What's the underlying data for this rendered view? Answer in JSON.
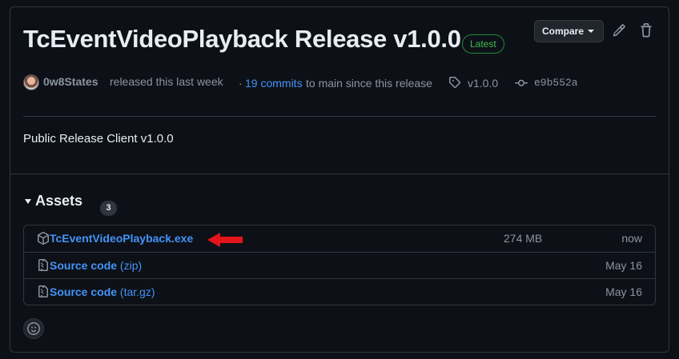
{
  "release": {
    "title": "TcEventVideoPlayback Release v1.0.0",
    "badge": "Latest",
    "compare_label": "Compare",
    "author": "0w8States",
    "released_text": "released this last week",
    "dot": "·",
    "commits_link": "19 commits",
    "commits_rest": "to main since this release",
    "tag": "v1.0.0",
    "commit": "e9b552a",
    "body": "Public Release Client v1.0.0"
  },
  "assets": {
    "label": "Assets",
    "count": "3",
    "items": [
      {
        "name": "TcEventVideoPlayback.exe",
        "ext": "",
        "size": "274 MB",
        "date": "now",
        "icon": "package-icon"
      },
      {
        "name": "Source code",
        "ext": "(zip)",
        "size": "",
        "date": "May 16",
        "icon": "file-zip-icon"
      },
      {
        "name": "Source code",
        "ext": "(tar.gz)",
        "size": "",
        "date": "May 16",
        "icon": "file-zip-icon"
      }
    ]
  },
  "colors": {
    "background": "#0d1117",
    "border": "#30363d",
    "link": "#4493f8",
    "latest_badge": "#3fb950",
    "annotation_arrow": "#e5141b"
  }
}
